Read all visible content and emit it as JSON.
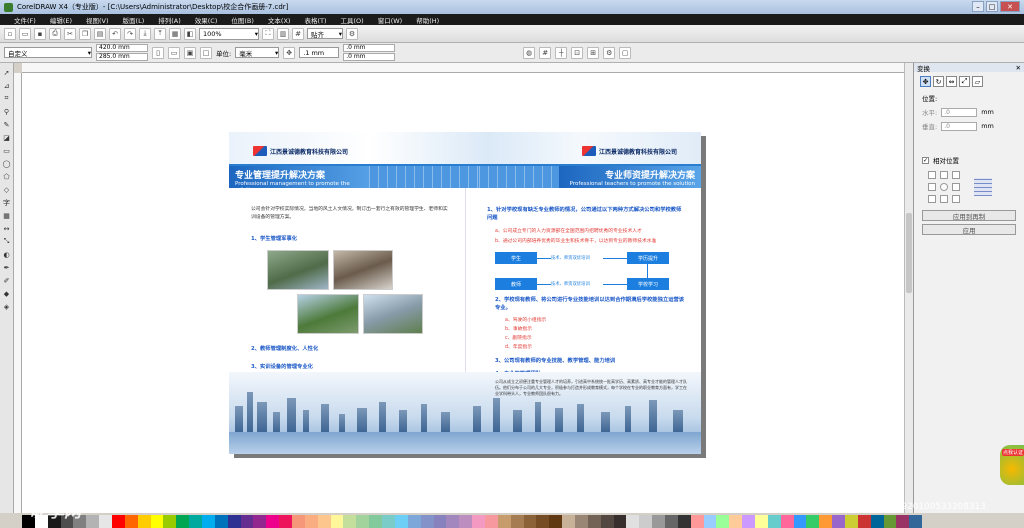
{
  "window": {
    "title": "CorelDRAW X4（专业版）- [C:\\Users\\Administrator\\Desktop\\校企合作画册-7.cdr]"
  },
  "menu": [
    "文件(F)",
    "编辑(E)",
    "视图(V)",
    "版面(L)",
    "排列(A)",
    "效果(C)",
    "位图(B)",
    "文本(X)",
    "表格(T)",
    "工具(O)",
    "窗口(W)",
    "帮助(H)"
  ],
  "toolbar": {
    "zoom": "100%",
    "snap": "贴齐"
  },
  "propbar": {
    "preset": "自定义",
    "width": "420.0 mm",
    "height": "285.0 mm",
    "units_label": "单位:",
    "units": "毫米",
    "nudge": ".1 mm",
    "dup_x": ".0 mm",
    "dup_y": ".0 mm"
  },
  "docker": {
    "title": "变换",
    "position_label": "位置:",
    "h_label": "水平:",
    "h_value": ".0",
    "h_unit": "mm",
    "v_label": "垂直:",
    "v_value": ".0",
    "v_unit": "mm",
    "relative": "相对位置",
    "apply_dup": "应用到再制",
    "apply": "应用"
  },
  "page": {
    "company": "江西景诚德教育科技有限公司",
    "left": {
      "title": "专业管理提升解决方案",
      "subtitle": "Professional management to promote the solution",
      "intro": "公司会针对学校实际情况，当地的风土人文情况，制订出一套行之有效的管理学生、老师和实训设备的管理方案。",
      "h1": "1、学生管理军事化",
      "h2": "2、教师管理制度化、人性化",
      "h3": "3、实训设备的管理专业化"
    },
    "right": {
      "title": "专业师资提升解决方案",
      "subtitle": "Professional teachers to promote the solution",
      "h1": "1、针对学校现有缺乏专业教师的情况，公司通过以下两种方式解决公司和学校教师问题",
      "a1": "a、公司成立专门的人力资源部在全国范围内招聘优秀的专业技术人才",
      "a2": "b、通过公司内部培养优秀的毕业生和技术骨干，以达到专业的教师技术水准",
      "flow_top": [
        "学生",
        "技术、师资双优培训",
        "学历提升"
      ],
      "flow_bottom": [
        "教师",
        "技术、师资双优培训",
        "学校学习"
      ],
      "h2": "2、学校现有教师、将公司进行专业技能培训以达到合作期满后学校能独立运营该专业。",
      "b": [
        "a、驾驶的小组指示",
        "b、事故指示",
        "c、剧院指示",
        "d、年度指示"
      ],
      "h3": "3、公司现有教师的专业技能、教学管理、能力培训",
      "h4": "4、专业的管理团队",
      "team": "公司从成立之初便注重专业管理人才的培养，引进高中系统统一批高学历、高素质、高专业才能的管理人才队伍。他们分布于公司的几大专业，积极参与打造并形成教育模式，每个学校在专业的职业教育方面有，学工在业学科带头人，专业教师团队很有力。"
    }
  },
  "status": {
    "watermark": "昵享网",
    "watermark_url": "www.nipic.com",
    "id_text": "ID:10253716 NO:20170920100533208313",
    "badge": "点我认证"
  },
  "palette": [
    "#000000",
    "#ffffff",
    "#1a1a1a",
    "#4d4d4d",
    "#808080",
    "#b3b3b3",
    "#e6e6e6",
    "#ff0000",
    "#ff6600",
    "#ffcc00",
    "#ffff00",
    "#99cc00",
    "#00a651",
    "#00a99d",
    "#00aeef",
    "#0072bc",
    "#2e3192",
    "#662d91",
    "#92278f",
    "#ec008c",
    "#ed145b",
    "#f7977a",
    "#fbad82",
    "#fdc68c",
    "#fff799",
    "#c4df9b",
    "#a3d39c",
    "#82ca9c",
    "#7accc8",
    "#6dcff6",
    "#7da7d9",
    "#8393ca",
    "#8781bd",
    "#a187be",
    "#bc8dbf",
    "#f49ac2",
    "#f6989d",
    "#c69c6d",
    "#a67c52",
    "#8c6239",
    "#754c24",
    "#603913",
    "#c7b299",
    "#998675",
    "#736357",
    "#534741",
    "#362f2d",
    "#e0e0e0",
    "#cccccc",
    "#999999",
    "#666666",
    "#333333",
    "#ff9999",
    "#99ccff",
    "#99ff99",
    "#ffcc99",
    "#cc99ff",
    "#ffff99",
    "#66cccc",
    "#ff6699",
    "#3399ff",
    "#33cc66",
    "#ff9933",
    "#9966cc",
    "#cccc33",
    "#cc3333",
    "#006699",
    "#669933",
    "#993366",
    "#336699"
  ]
}
